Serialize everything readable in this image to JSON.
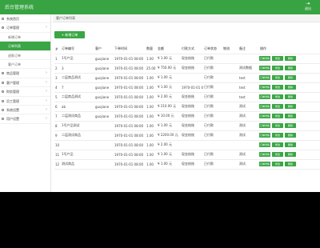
{
  "header": {
    "brand": "后台管理系统",
    "exit_icon": "logout-icon",
    "exit_label": "退出"
  },
  "sidebar": {
    "items": [
      {
        "label": "系统首页",
        "level": 0,
        "icon": "home-icon"
      },
      {
        "label": "订单管理",
        "level": 0,
        "icon": "menu-icon",
        "expanded": true
      },
      {
        "label": "新增订单",
        "level": 1
      },
      {
        "label": "订单列表",
        "level": 1,
        "active": true
      },
      {
        "label": "退款订单",
        "level": 1
      },
      {
        "label": "客户订单",
        "level": 1
      },
      {
        "label": "商品管理",
        "level": 0
      },
      {
        "label": "客户管理",
        "level": 0
      },
      {
        "label": "财务管理",
        "level": 0
      },
      {
        "label": "员工管理",
        "level": 0
      },
      {
        "label": "系统设置",
        "level": 0
      },
      {
        "label": "用户设置",
        "level": 0
      }
    ]
  },
  "breadcrumb": "客户订单列表",
  "toolbar": {
    "add_label": "+ 新增订单"
  },
  "table": {
    "columns": [
      "#",
      "订单编号",
      "客户",
      "下单时间",
      "数量",
      "金额",
      "付款方式",
      "订单状态",
      "物流",
      "备注",
      "操作"
    ],
    "rows": [
      [
        "1",
        "1号产品",
        "guojiane",
        "1970-01-01 08:00",
        "1.00",
        "¥ 1.00 元",
        "现金结账",
        "已付款",
        "",
        "",
        ""
      ],
      [
        "2",
        "3",
        "guojiane",
        "1970-01-01 08:00",
        "25.00",
        "¥ 750.00 元",
        "现金结账",
        "已付款",
        "",
        "测试数据",
        ""
      ],
      [
        "3",
        "二层商品测试",
        "guojiane",
        "1970-01-01 08:00",
        "1.00",
        "¥ 1.00 元",
        "",
        "已付款",
        "",
        "test",
        ""
      ],
      [
        "4",
        "7",
        "guojiane",
        "1970-01-01 08:00",
        "1.00",
        "¥ 1.00 元",
        "1970-01-01 08:00",
        "已付款",
        "",
        "test",
        ""
      ],
      [
        "5",
        "二层商品测试",
        "guojiane",
        "1970-01-01 08:00",
        "1.00",
        "¥ 2.00 元",
        "现金结账",
        "已付款",
        "",
        "test",
        ""
      ],
      [
        "6",
        "ab",
        "guojiane",
        "1970-01-01 08:00",
        "1.00",
        "¥ 210.00 元",
        "现金结账",
        "已付款",
        "",
        "测试",
        ""
      ],
      [
        "7",
        "二层测试商品",
        "guojiane",
        "1970-01-01 08:00",
        "1.00",
        "¥ 10.00 元",
        "现金结账",
        "已付款",
        "",
        "测试",
        ""
      ],
      [
        "8",
        "1号产品测试",
        "",
        "1970-01-01 08:00",
        "1.00",
        "¥ 1.00 元",
        "现金结账",
        "已付款",
        "",
        "测试",
        ""
      ],
      [
        "9",
        "二层测试商品",
        "",
        "1970-01-01 08:00",
        "1.00",
        "¥ 2200.00 元",
        "现金结账",
        "已付款",
        "",
        "测试",
        ""
      ],
      [
        "10",
        "",
        "",
        "1970-01-01 08:00",
        "1.00",
        "¥ 2.00 元",
        "",
        "",
        "",
        "",
        ""
      ],
      [
        "11",
        "1号产品",
        "",
        "1970-01-01 08:00",
        "1.00",
        "¥ 1.00 元",
        "现金结账",
        "已付款",
        "",
        "测试",
        ""
      ],
      [
        "12",
        "测试商品",
        "",
        "1970-01-01 08:00",
        "1.00",
        "¥ 1.00 元",
        "现金结账",
        "已付款",
        "",
        "测试",
        ""
      ]
    ],
    "actions": [
      "订单详情",
      "修改",
      "删除"
    ]
  },
  "colors": {
    "accent": "#3aa645",
    "topbar": "#38a343",
    "footer": "#000000"
  }
}
